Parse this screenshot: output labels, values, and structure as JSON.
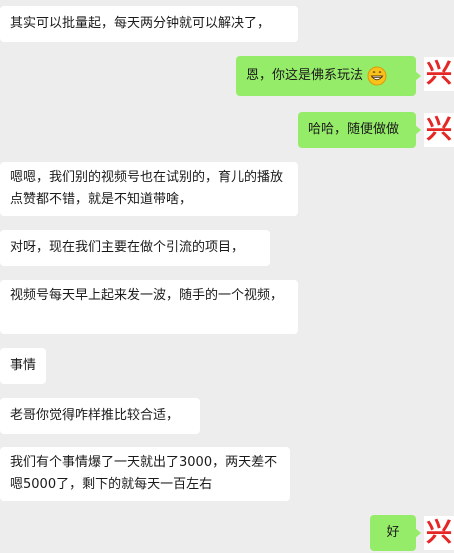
{
  "messages": [
    {
      "side": "in",
      "text": "其实可以批量起，每天两分钟就可以解决了，"
    },
    {
      "side": "out",
      "text": "恩，你这是佛系玩法",
      "emoji": "grinning-face-icon"
    },
    {
      "side": "out",
      "text": "哈哈，随便做做"
    },
    {
      "side": "in",
      "text": "嗯嗯，我们别的视频号也在试别的，育儿的播放点赞都不错，就是不知道带啥，"
    },
    {
      "side": "in",
      "text": "对呀，现在我们主要在做个引流的项目，"
    },
    {
      "side": "in",
      "text": "视频号每天早上起来发一波，随手的一个视频，"
    },
    {
      "side": "in",
      "text": "事情"
    },
    {
      "side": "in",
      "text": "老哥你觉得咋样推比较合适，"
    },
    {
      "side": "in",
      "text": "我们有个事情爆了一天就出了3000，两天差不嗯5000了，剩下的就每天一百左右"
    },
    {
      "side": "out",
      "text": "好"
    }
  ],
  "avatar_glyph": "兴",
  "colors": {
    "background": "#ededed",
    "incoming_bubble": "#ffffff",
    "outgoing_bubble": "#95ec69",
    "avatar_text": "#e62525"
  }
}
